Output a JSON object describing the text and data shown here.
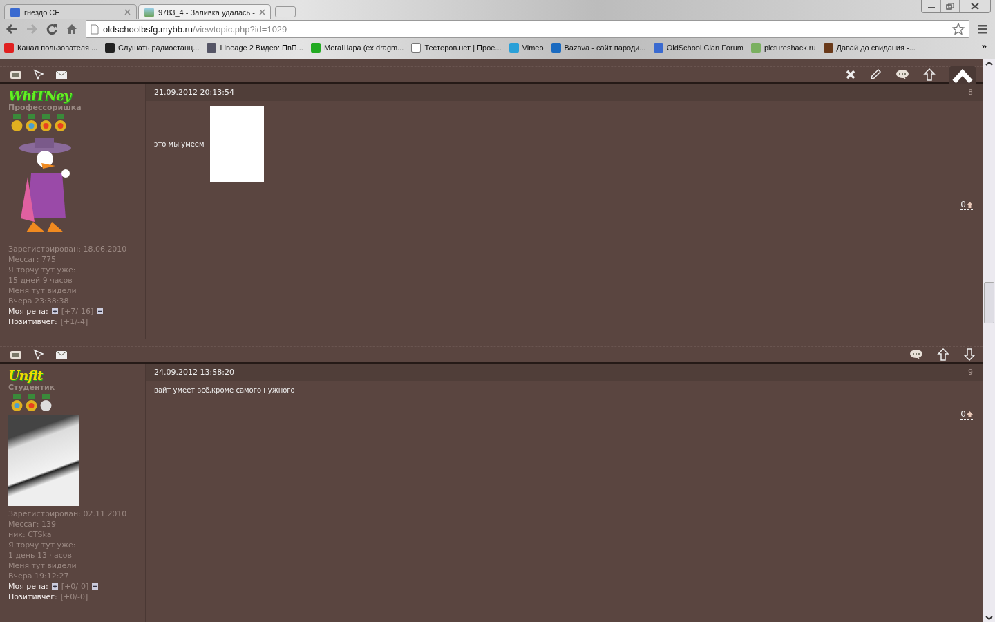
{
  "browser": {
    "tabs": [
      {
        "title": "гнездо CE",
        "selected": false
      },
      {
        "title": "9783_4 - Заливка удалась -",
        "selected": true
      }
    ],
    "address": {
      "host": "oldschoolbsfg.mybb.ru",
      "path": "/viewtopic.php?id=1029"
    },
    "bookmarks": [
      {
        "label": "Канал пользователя ..."
      },
      {
        "label": "Слушать радиостанц..."
      },
      {
        "label": "Lineage 2 Видео: ПвП..."
      },
      {
        "label": "МегаШара (ex dragm..."
      },
      {
        "label": "Тестеров.нет | Прое..."
      },
      {
        "label": "Vimeo"
      },
      {
        "label": "Bazava - сайт пароди..."
      },
      {
        "label": "OldSchool Clan Forum"
      },
      {
        "label": "pictureshack.ru"
      },
      {
        "label": "Давай до свидания -..."
      }
    ],
    "more": "»"
  },
  "posts": [
    {
      "actions": [
        {
          "kind": "delete"
        },
        {
          "kind": "edit"
        },
        {
          "kind": "quote"
        },
        {
          "kind": "up"
        }
      ],
      "author": {
        "name": "WhiTNey",
        "color": "#66ee22",
        "rank": "Профессоришка",
        "medals": [
          {
            "kind": "eagle"
          },
          {
            "kind": "globe"
          },
          {
            "kind": "star"
          },
          {
            "kind": "star"
          }
        ],
        "avatar": {
          "kind": "cartoon"
        },
        "stats": [
          "Зарегистрирован: 18.06.2010",
          "Мессаг: 775",
          "Я торчу тут уже:",
          "15 дней 9 часов",
          "Меня тут видели",
          "Вчера 23:38:38"
        ],
        "rep": {
          "label": "Моя репа:",
          "value": "[+7/-16]"
        },
        "positive": {
          "label": "Позитивчег:",
          "value": "[+1/-4]"
        }
      },
      "date": "21.09.2012 20:13:54",
      "number": "8",
      "text": "это мы умеем",
      "image": {
        "kind": "picture"
      },
      "rating": "0"
    },
    {
      "actions": [
        {
          "kind": "quote"
        },
        {
          "kind": "up"
        },
        {
          "kind": "down"
        }
      ],
      "author": {
        "name": "Unfit",
        "color": "#eedd00",
        "rank": "Студентик",
        "medals": [
          {
            "kind": "globe"
          },
          {
            "kind": "star"
          },
          {
            "kind": "silver"
          }
        ],
        "avatar": {
          "kind": "photo"
        },
        "stats": [
          "Зарегистрирован: 02.11.2010",
          "Мессаг: 139",
          "ник: CTSka",
          "Я торчу тут уже:",
          "1 день 13 часов",
          "Меня тут видели",
          "Вчера 19:12:27"
        ],
        "rep": {
          "label": "Моя репа:",
          "value": "[+0/-0]"
        },
        "positive": {
          "label": "Позитивчег:",
          "value": "[+0/-0]"
        }
      },
      "date": "24.09.2012 13:58:20",
      "number": "9",
      "text": "вайт умеет всё,кроме самого нужного",
      "rating": "0"
    }
  ]
}
